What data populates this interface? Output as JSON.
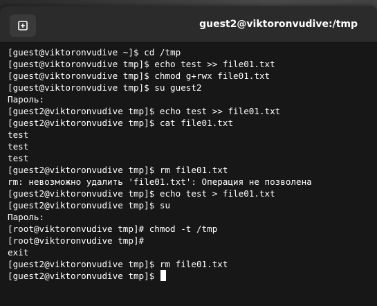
{
  "window": {
    "title": "guest2@viktoronvudive:/tmp"
  },
  "icons": {
    "new_tab": "new-tab-icon"
  },
  "colors": {
    "terminal_bg": "#171717",
    "titlebar_bg": "#2b2b2b",
    "text": "#ffffff"
  },
  "terminal": {
    "lines": [
      "[guest@viktoronvudive ~]$ cd /tmp",
      "[guest@viktoronvudive tmp]$ echo test >> file01.txt",
      "[guest@viktoronvudive tmp]$ chmod g+rwx file01.txt",
      "[guest@viktoronvudive tmp]$ su guest2",
      "Пароль:",
      "[guest2@viktoronvudive tmp]$ echo test >> file01.txt",
      "[guest2@viktoronvudive tmp]$ cat file01.txt",
      "test",
      "test",
      "test",
      "[guest2@viktoronvudive tmp]$ rm file01.txt",
      "rm: невозможно удалить 'file01.txt': Операция не позволена",
      "[guest2@viktoronvudive tmp]$ echo test > file01.txt",
      "[guest2@viktoronvudive tmp]$ su",
      "Пароль:",
      "[root@viktoronvudive tmp]# chmod -t /tmp",
      "[root@viktoronvudive tmp]#",
      "exit",
      "[guest2@viktoronvudive tmp]$ rm file01.txt"
    ],
    "prompt": "[guest2@viktoronvudive tmp]$ "
  }
}
